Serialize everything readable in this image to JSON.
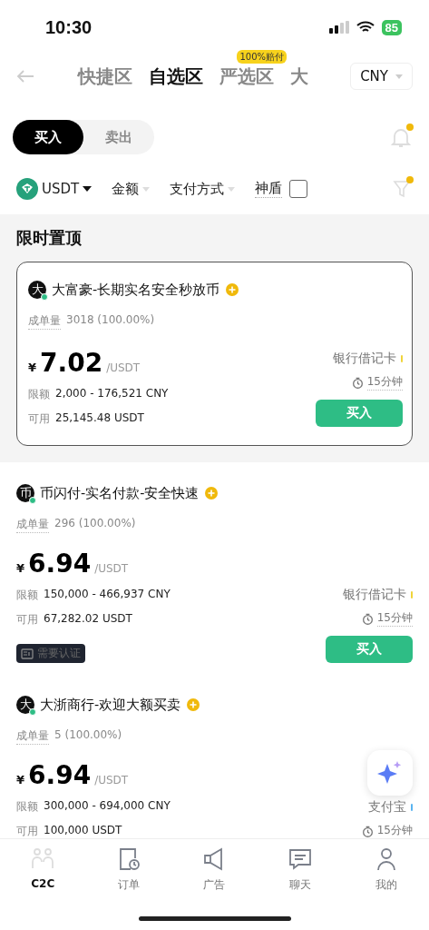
{
  "status_bar": {
    "time": "10:30",
    "battery": "85"
  },
  "nav": {
    "tabs": [
      {
        "label": "快捷区",
        "selected": false
      },
      {
        "label": "自选区",
        "selected": true
      },
      {
        "label": "严选区",
        "selected": false,
        "badge": "100%赔付"
      },
      {
        "label": "大",
        "selected": false
      }
    ],
    "currency": "CNY"
  },
  "trade_toggle": [
    {
      "label": "买入",
      "selected": true
    },
    {
      "label": "卖出",
      "selected": false
    }
  ],
  "filters": {
    "coin": "USDT",
    "amount": "金额",
    "payment": "支付方式",
    "shield": {
      "label": "神盾",
      "checked": false
    }
  },
  "pinned_section": {
    "title": "限时置顶",
    "listings": [
      {
        "avatar": "大",
        "name": "大富豪-长期实名安全秒放币",
        "orders_label": "成单量",
        "orders": "3018 (100.00%)",
        "currency_sign": "¥",
        "price": "7.02",
        "unit": "/USDT",
        "limit_label": "限额",
        "limit": "2,000 - 176,521 CNY",
        "available_label": "可用",
        "available": "25,145.48 USDT",
        "payment": {
          "label": "银行借记卡",
          "color": "#f0d43a"
        },
        "time": "15分钟",
        "button": "买入"
      }
    ]
  },
  "listings": [
    {
      "avatar": "币",
      "name": "币闪付-实名付款-安全快速",
      "orders_label": "成单量",
      "orders": "296 (100.00%)",
      "currency_sign": "¥",
      "price": "6.94",
      "unit": "/USDT",
      "limit_label": "限额",
      "limit": "150,000 - 466,937 CNY",
      "available_label": "可用",
      "available": "67,282.02 USDT",
      "payment": {
        "label": "银行借记卡",
        "color": "#f0d43a"
      },
      "time": "15分钟",
      "button": "买入",
      "tag": "需要认证"
    },
    {
      "avatar": "大",
      "name": "大浙商行-欢迎大额买卖",
      "orders_label": "成单量",
      "orders": "5 (100.00%)",
      "currency_sign": "¥",
      "price": "6.94",
      "unit": "/USDT",
      "limit_label": "限额",
      "limit": "300,000 - 694,000 CNY",
      "available_label": "可用",
      "available": "100,000 USDT",
      "payment": {
        "label": "支付宝",
        "color": "#5ab4f0"
      },
      "time": "15分钟"
    }
  ],
  "bottom_nav": [
    {
      "label": "C2C",
      "selected": true,
      "kind": "c2c"
    },
    {
      "label": "订单",
      "selected": false,
      "kind": "orders"
    },
    {
      "label": "广告",
      "selected": false,
      "kind": "ads"
    },
    {
      "label": "聊天",
      "selected": false,
      "kind": "chat"
    },
    {
      "label": "我的",
      "selected": false,
      "kind": "me"
    }
  ]
}
